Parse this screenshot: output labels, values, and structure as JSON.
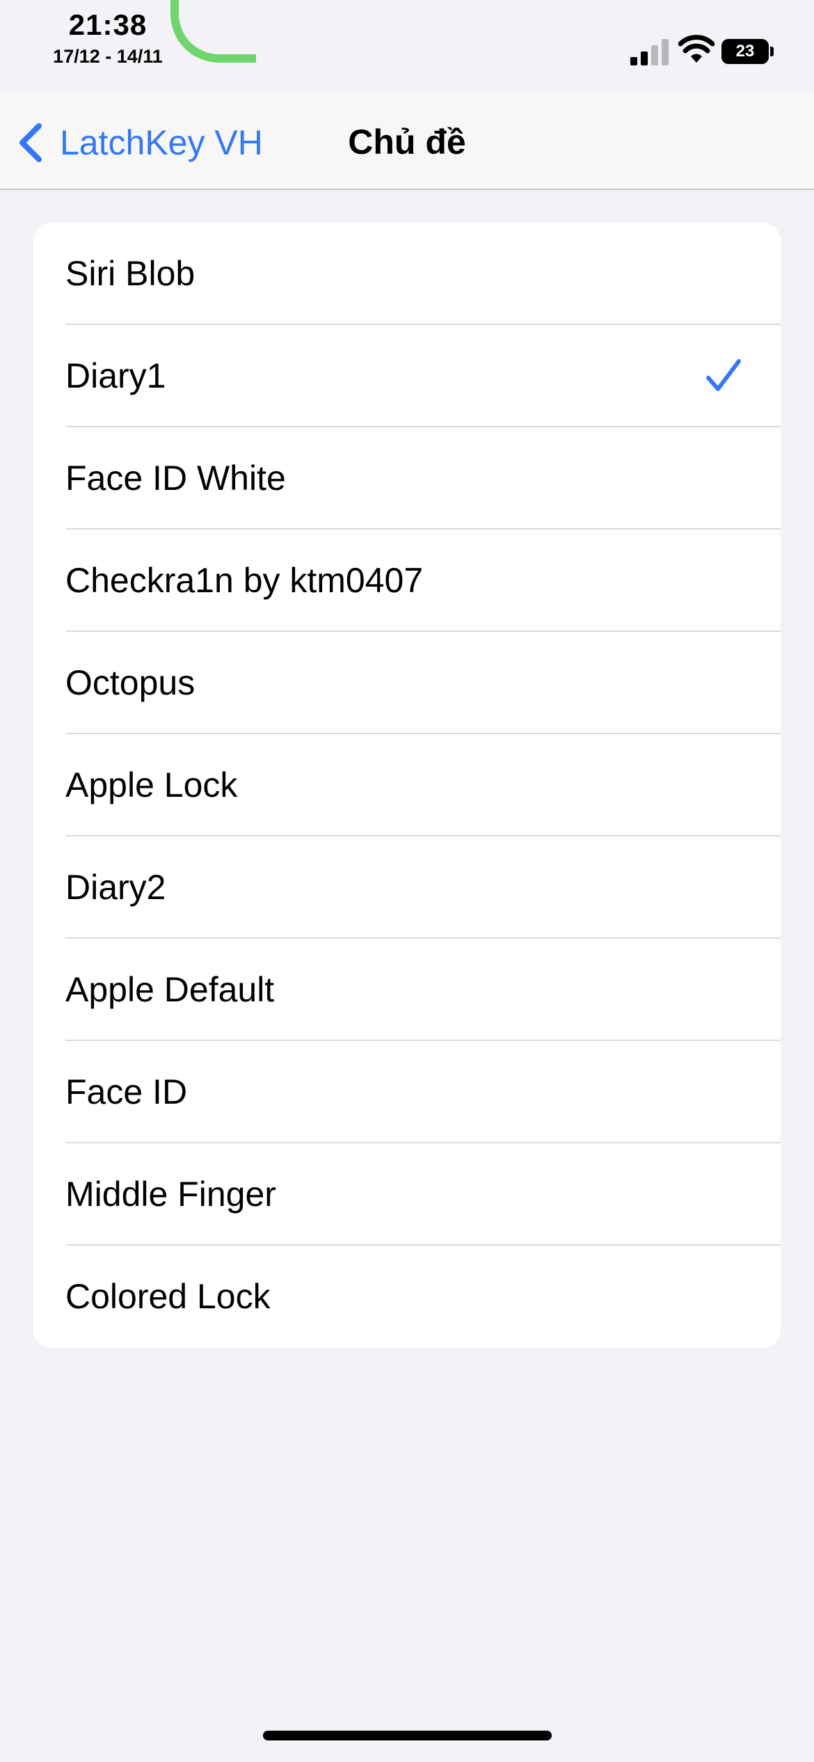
{
  "status_bar": {
    "time": "21:38",
    "date": "17/12 - 14/11",
    "battery_level": "23",
    "signal_bars_filled": 2,
    "signal_bars_total": 4
  },
  "nav": {
    "back_label": "LatchKey VH",
    "title": "Chủ đề"
  },
  "themes": {
    "items": [
      {
        "label": "Siri Blob",
        "selected": false
      },
      {
        "label": "Diary1",
        "selected": true
      },
      {
        "label": "Face ID White",
        "selected": false
      },
      {
        "label": "Checkra1n by ktm0407",
        "selected": false
      },
      {
        "label": "Octopus",
        "selected": false
      },
      {
        "label": "Apple Lock",
        "selected": false
      },
      {
        "label": "Diary2",
        "selected": false
      },
      {
        "label": "Apple Default",
        "selected": false
      },
      {
        "label": "Face ID",
        "selected": false
      },
      {
        "label": "Middle Finger",
        "selected": false
      },
      {
        "label": "Colored Lock",
        "selected": false
      }
    ]
  },
  "colors": {
    "accent": "#3478f6",
    "background": "#f2f2f7",
    "indicator_arc": "#6fd56f"
  },
  "icons": {
    "back": "chevron-left-icon",
    "checkmark": "checkmark-icon",
    "wifi": "wifi-icon",
    "signal": "cellular-signal-icon",
    "battery": "battery-icon"
  }
}
